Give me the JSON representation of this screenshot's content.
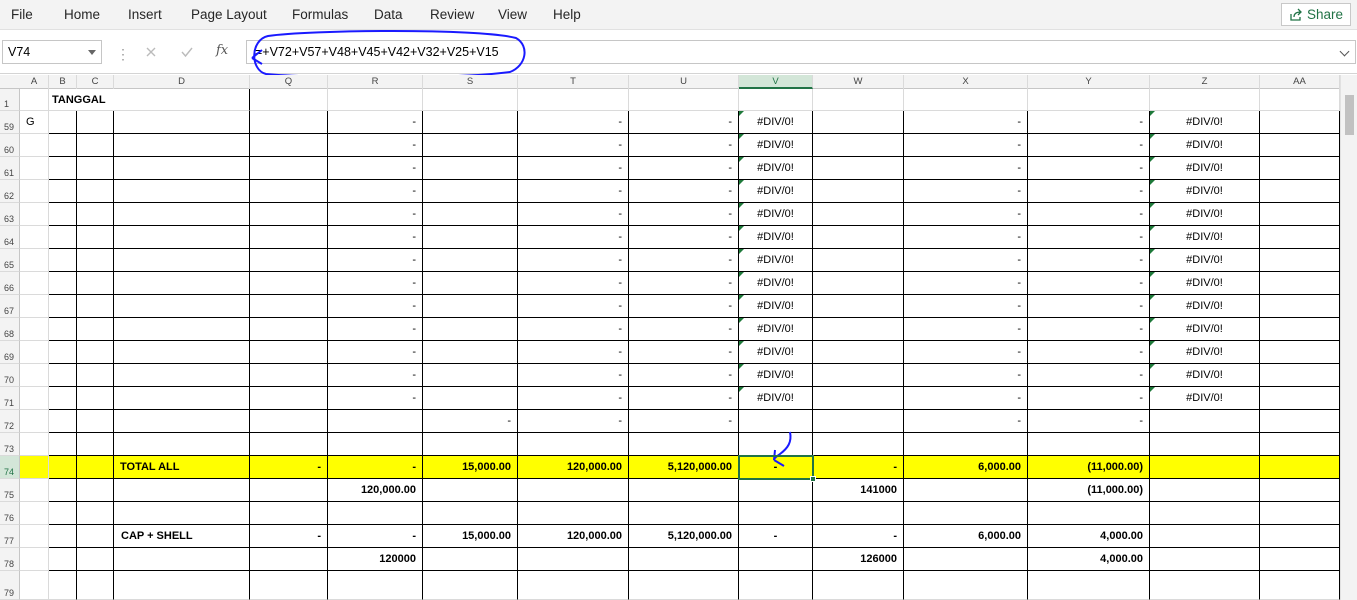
{
  "menu": {
    "file": "File",
    "home": "Home",
    "insert": "Insert",
    "page_layout": "Page Layout",
    "formulas": "Formulas",
    "data": "Data",
    "review": "Review",
    "view": "View",
    "help": "Help",
    "share": "Share"
  },
  "formula_bar": {
    "name_box": "V74",
    "formula": "=+V72+V57+V48+V45+V42+V32+V25+V15",
    "fx_label": "fx"
  },
  "columns": [
    "A",
    "B",
    "C",
    "D",
    "Q",
    "R",
    "S",
    "T",
    "U",
    "V",
    "W",
    "X",
    "Y",
    "Z",
    "AA"
  ],
  "selected_column": "V",
  "rows": [
    {
      "num": "1",
      "cells": {
        "B": "TANGGAL"
      }
    },
    {
      "num": "59",
      "cells": {
        "A": "G",
        "R": "-",
        "T": "-",
        "U": "-",
        "V": "#DIV/0!",
        "X": "-",
        "Y": "-",
        "Z": "#DIV/0!"
      }
    },
    {
      "num": "60",
      "cells": {
        "R": "-",
        "T": "-",
        "U": "-",
        "V": "#DIV/0!",
        "X": "-",
        "Y": "-",
        "Z": "#DIV/0!"
      }
    },
    {
      "num": "61",
      "cells": {
        "R": "-",
        "T": "-",
        "U": "-",
        "V": "#DIV/0!",
        "X": "-",
        "Y": "-",
        "Z": "#DIV/0!"
      }
    },
    {
      "num": "62",
      "cells": {
        "R": "-",
        "T": "-",
        "U": "-",
        "V": "#DIV/0!",
        "X": "-",
        "Y": "-",
        "Z": "#DIV/0!"
      }
    },
    {
      "num": "63",
      "cells": {
        "R": "-",
        "T": "-",
        "U": "-",
        "V": "#DIV/0!",
        "X": "-",
        "Y": "-",
        "Z": "#DIV/0!"
      }
    },
    {
      "num": "64",
      "cells": {
        "R": "-",
        "T": "-",
        "U": "-",
        "V": "#DIV/0!",
        "X": "-",
        "Y": "-",
        "Z": "#DIV/0!"
      }
    },
    {
      "num": "65",
      "cells": {
        "R": "-",
        "T": "-",
        "U": "-",
        "V": "#DIV/0!",
        "X": "-",
        "Y": "-",
        "Z": "#DIV/0!"
      }
    },
    {
      "num": "66",
      "cells": {
        "R": "-",
        "T": "-",
        "U": "-",
        "V": "#DIV/0!",
        "X": "-",
        "Y": "-",
        "Z": "#DIV/0!"
      }
    },
    {
      "num": "67",
      "cells": {
        "R": "-",
        "T": "-",
        "U": "-",
        "V": "#DIV/0!",
        "X": "-",
        "Y": "-",
        "Z": "#DIV/0!"
      }
    },
    {
      "num": "68",
      "cells": {
        "R": "-",
        "T": "-",
        "U": "-",
        "V": "#DIV/0!",
        "X": "-",
        "Y": "-",
        "Z": "#DIV/0!"
      }
    },
    {
      "num": "69",
      "cells": {
        "R": "-",
        "T": "-",
        "U": "-",
        "V": "#DIV/0!",
        "X": "-",
        "Y": "-",
        "Z": "#DIV/0!"
      }
    },
    {
      "num": "70",
      "cells": {
        "R": "-",
        "T": "-",
        "U": "-",
        "V": "#DIV/0!",
        "X": "-",
        "Y": "-",
        "Z": "#DIV/0!"
      }
    },
    {
      "num": "71",
      "cells": {
        "R": "-",
        "T": "-",
        "U": "-",
        "V": "#DIV/0!",
        "X": "-",
        "Y": "-",
        "Z": "#DIV/0!"
      }
    },
    {
      "num": "72",
      "cells": {
        "S": "-",
        "T": "-",
        "U": "-",
        "X": "-",
        "Y": "-"
      }
    },
    {
      "num": "73",
      "cells": {}
    },
    {
      "num": "74",
      "cells": {
        "D": "TOTAL ALL",
        "Q": "-",
        "R": "-",
        "S": "15,000.00",
        "T": "120,000.00",
        "U": "5,120,000.00",
        "V": "-",
        "W": "-",
        "X": "6,000.00",
        "Y": "(11,000.00)"
      }
    },
    {
      "num": "75",
      "cells": {
        "R": "120,000.00",
        "W": "141000",
        "Y": "(11,000.00)"
      }
    },
    {
      "num": "76",
      "cells": {}
    },
    {
      "num": "77",
      "cells": {
        "D": "CAP + SHELL",
        "Q": "-",
        "R": "-",
        "S": "15,000.00",
        "T": "120,000.00",
        "U": "5,120,000.00",
        "V": "-",
        "W": "-",
        "X": "6,000.00",
        "Y": "4,000.00"
      }
    },
    {
      "num": "78",
      "cells": {
        "R": "120000",
        "W": "126000",
        "Y": "4,000.00"
      }
    },
    {
      "num": "79",
      "cells": {}
    }
  ],
  "colors": {
    "accent": "#217346",
    "highlight_row": "#ffff00",
    "annotation": "#1a1aff"
  }
}
